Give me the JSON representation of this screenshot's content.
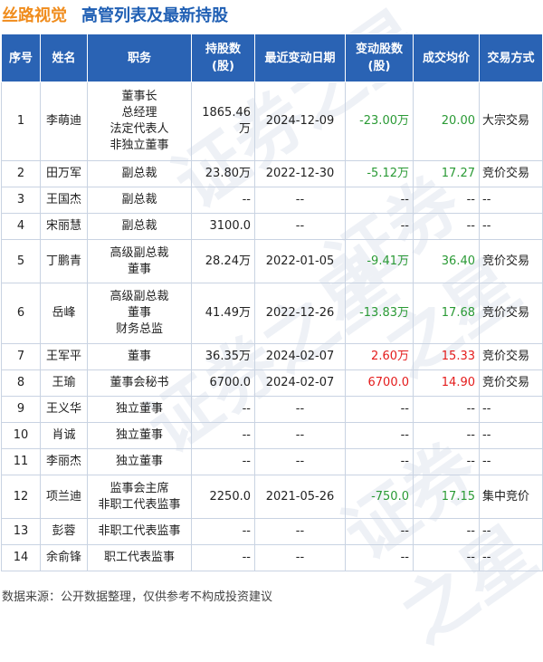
{
  "header": {
    "company": "丝路视觉",
    "subtitle": "高管列表及最新持股"
  },
  "watermark": {
    "text": "证券之星"
  },
  "table": {
    "headers": [
      "序号",
      "姓名",
      "职务",
      "持股数\n(股)",
      "最近变动日期",
      "变动股数\n(股)",
      "成交均价",
      "交易方式"
    ],
    "rows": [
      {
        "no": "1",
        "name": "李萌迪",
        "titles": [
          "董事长",
          "总经理",
          "法定代表人",
          "非独立董事"
        ],
        "shares": "1865.46万",
        "date": "2024-12-09",
        "change": "-23.00万",
        "change_sign": "neg",
        "price": "20.00",
        "price_sign": "neg",
        "method": "大宗交易"
      },
      {
        "no": "2",
        "name": "田万军",
        "titles": [
          "副总裁"
        ],
        "shares": "23.80万",
        "date": "2022-12-30",
        "change": "-5.12万",
        "change_sign": "neg",
        "price": "17.27",
        "price_sign": "neg",
        "method": "竞价交易"
      },
      {
        "no": "3",
        "name": "王国杰",
        "titles": [
          "副总裁"
        ],
        "shares": "--",
        "date": "--",
        "change": "--",
        "change_sign": "none",
        "price": "--",
        "price_sign": "none",
        "method": "--"
      },
      {
        "no": "4",
        "name": "宋丽慧",
        "titles": [
          "副总裁"
        ],
        "shares": "3100.0",
        "date": "--",
        "change": "--",
        "change_sign": "none",
        "price": "--",
        "price_sign": "none",
        "method": "--"
      },
      {
        "no": "5",
        "name": "丁鹏青",
        "titles": [
          "高级副总裁",
          "董事"
        ],
        "shares": "28.24万",
        "date": "2022-01-05",
        "change": "-9.41万",
        "change_sign": "neg",
        "price": "36.40",
        "price_sign": "neg",
        "method": "竞价交易"
      },
      {
        "no": "6",
        "name": "岳峰",
        "titles": [
          "高级副总裁",
          "董事",
          "财务总监"
        ],
        "shares": "41.49万",
        "date": "2022-12-26",
        "change": "-13.83万",
        "change_sign": "neg",
        "price": "17.68",
        "price_sign": "neg",
        "method": "竞价交易"
      },
      {
        "no": "7",
        "name": "王军平",
        "titles": [
          "董事"
        ],
        "shares": "36.35万",
        "date": "2024-02-07",
        "change": "2.60万",
        "change_sign": "pos",
        "price": "15.33",
        "price_sign": "pos",
        "method": "竞价交易"
      },
      {
        "no": "8",
        "name": "王瑜",
        "titles": [
          "董事会秘书"
        ],
        "shares": "6700.0",
        "date": "2024-02-07",
        "change": "6700.0",
        "change_sign": "pos",
        "price": "14.90",
        "price_sign": "pos",
        "method": "竞价交易"
      },
      {
        "no": "9",
        "name": "王义华",
        "titles": [
          "独立董事"
        ],
        "shares": "--",
        "date": "--",
        "change": "--",
        "change_sign": "none",
        "price": "--",
        "price_sign": "none",
        "method": "--"
      },
      {
        "no": "10",
        "name": "肖诚",
        "titles": [
          "独立董事"
        ],
        "shares": "--",
        "date": "--",
        "change": "--",
        "change_sign": "none",
        "price": "--",
        "price_sign": "none",
        "method": "--"
      },
      {
        "no": "11",
        "name": "李丽杰",
        "titles": [
          "独立董事"
        ],
        "shares": "--",
        "date": "--",
        "change": "--",
        "change_sign": "none",
        "price": "--",
        "price_sign": "none",
        "method": "--"
      },
      {
        "no": "12",
        "name": "项兰迪",
        "titles": [
          "监事会主席",
          "非职工代表监事"
        ],
        "shares": "2250.0",
        "date": "2021-05-26",
        "change": "-750.0",
        "change_sign": "neg",
        "price": "17.15",
        "price_sign": "neg",
        "method": "集中竞价"
      },
      {
        "no": "13",
        "name": "彭蓉",
        "titles": [
          "非职工代表监事"
        ],
        "shares": "--",
        "date": "--",
        "change": "--",
        "change_sign": "none",
        "price": "--",
        "price_sign": "none",
        "method": "--"
      },
      {
        "no": "14",
        "name": "余俞锋",
        "titles": [
          "职工代表监事"
        ],
        "shares": "--",
        "date": "--",
        "change": "--",
        "change_sign": "none",
        "price": "--",
        "price_sign": "none",
        "method": "--"
      }
    ]
  },
  "footer": {
    "source": "数据来源：公开数据整理，仅供参考不构成投资建议"
  },
  "colors": {
    "header_bg": "#2a63b4",
    "company": "#f08c1c",
    "subtitle": "#1f5fb4",
    "negative": "#2a9a35",
    "positive": "#e41c1c"
  }
}
